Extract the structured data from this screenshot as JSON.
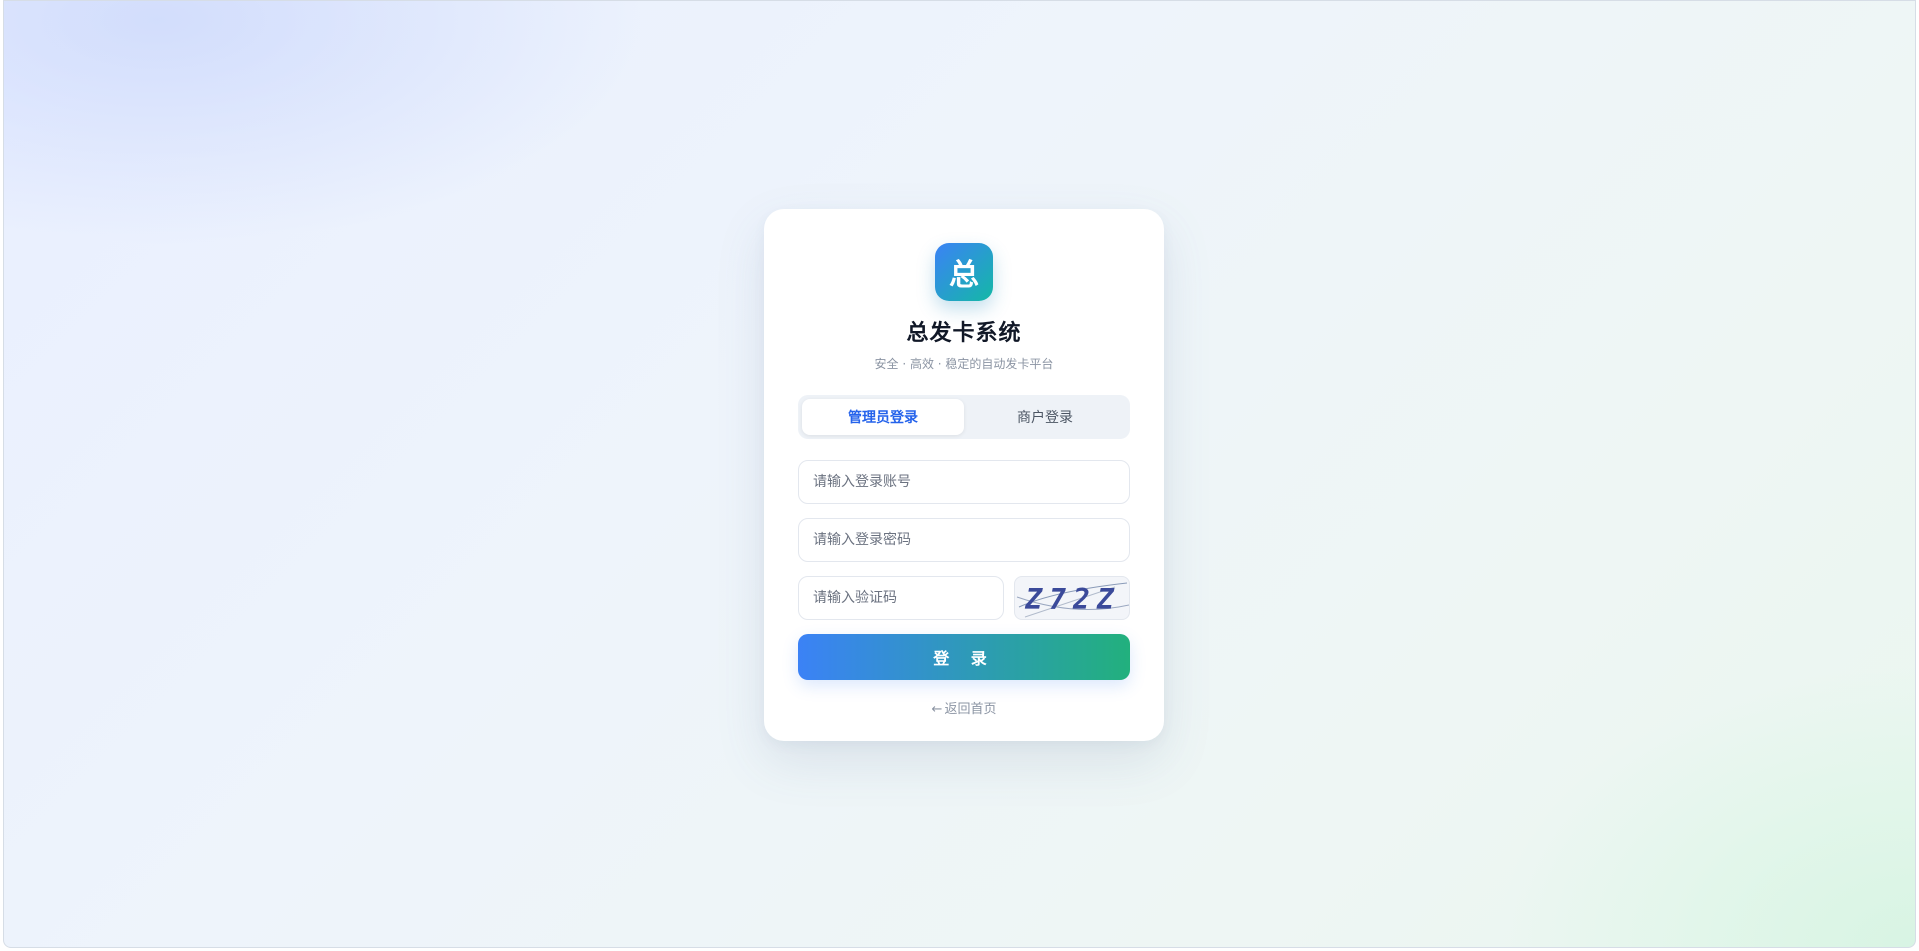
{
  "brand": {
    "logo_char": "总",
    "title": "总发卡系统",
    "subtitle": "安全 · 高效 · 稳定的自动发卡平台"
  },
  "tabs": [
    {
      "label": "管理员登录",
      "active": true
    },
    {
      "label": "商户登录",
      "active": false
    }
  ],
  "form": {
    "account_placeholder": "请输入登录账号",
    "password_placeholder": "请输入登录密码",
    "captcha_placeholder": "请输入验证码",
    "captcha_code": "Z72Z",
    "login_label": "登 录"
  },
  "footer": {
    "back_arrow": "←",
    "back_label": "返回首页"
  },
  "colors": {
    "accent": "#2563eb",
    "gradient_start": "#3b82f6",
    "gradient_end": "#22b07d"
  },
  "icons": {
    "logo": "brand-logo-icon",
    "back": "arrow-left-icon"
  }
}
